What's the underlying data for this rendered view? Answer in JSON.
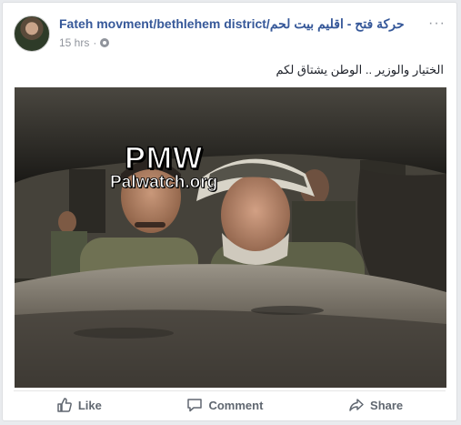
{
  "post": {
    "page_name": "Fateh movment/bethlehem district/",
    "page_name_arabic": "حركة فتح - اقليم بيت لحم",
    "time": "15 hrs",
    "separator": "·",
    "privacy_icon": "globe-icon",
    "more_icon": "ellipsis-icon",
    "more_label": "···",
    "text": "الختيار والوزير .. الوطن يشتاق لكم"
  },
  "photo": {
    "watermark_line1": "PMW",
    "watermark_line2": "Palwatch.org"
  },
  "actions": {
    "like_label": "Like",
    "like_icon": "thumbs-up-icon",
    "comment_label": "Comment",
    "comment_icon": "speech-bubble-icon",
    "share_label": "Share",
    "share_icon": "share-arrow-icon"
  },
  "colors": {
    "link": "#365899",
    "meta": "#90949c",
    "action_text": "#606770",
    "background": "#e9ebee"
  }
}
